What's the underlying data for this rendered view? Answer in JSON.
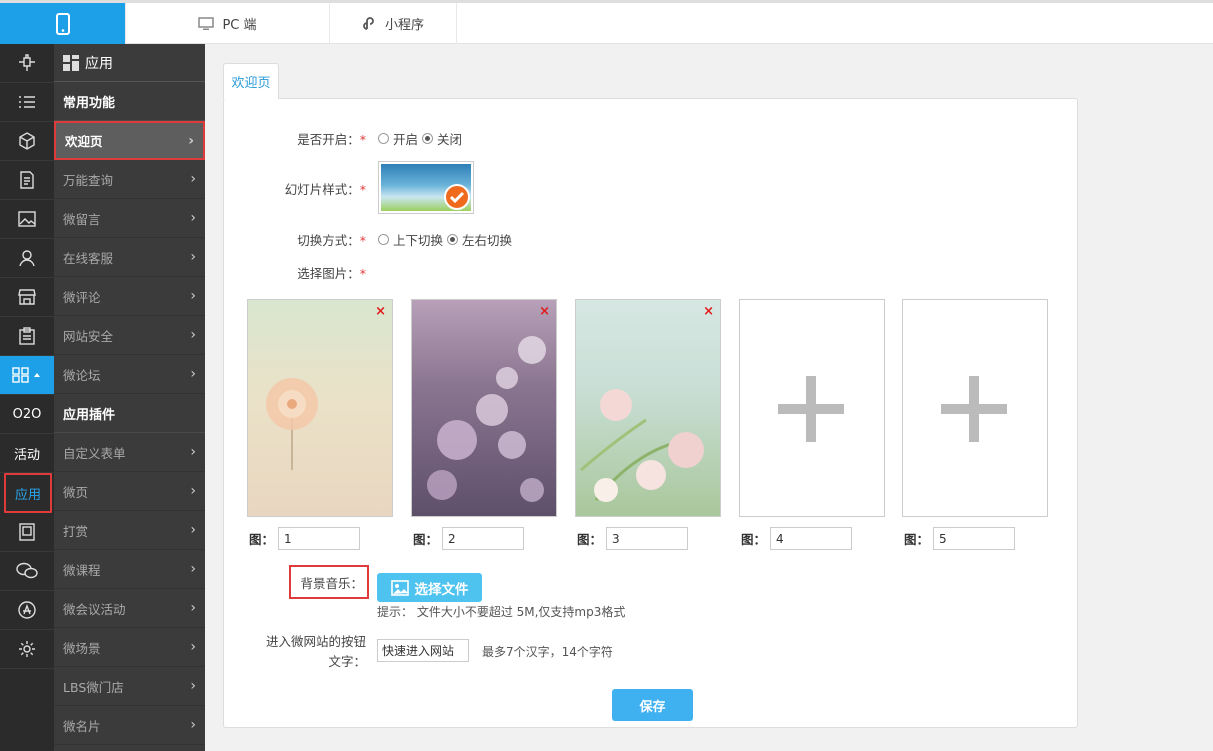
{
  "topbar": {
    "pc_label": "PC 端",
    "mini_label": "小程序"
  },
  "iconbar": {
    "items": [
      {
        "icon": "plug-icon"
      },
      {
        "icon": "list-icon"
      },
      {
        "icon": "cube-icon"
      },
      {
        "icon": "document-icon"
      },
      {
        "icon": "image-icon"
      },
      {
        "icon": "user-icon"
      },
      {
        "icon": "store-icon"
      },
      {
        "icon": "clipboard-icon"
      },
      {
        "icon": "apps-grid-icon"
      },
      {
        "label": "O2O"
      },
      {
        "label": "活动"
      },
      {
        "label": "应用"
      },
      {
        "icon": "frame-icon"
      },
      {
        "icon": "wechat-icon"
      },
      {
        "icon": "appstore-icon"
      },
      {
        "icon": "gear-icon"
      }
    ]
  },
  "menu": {
    "header": "应用",
    "section1": "常用功能",
    "items1": [
      "欢迎页",
      "万能查询",
      "微留言",
      "在线客服",
      "微评论",
      "网站安全",
      "微论坛"
    ],
    "section2": "应用插件",
    "items2": [
      "自定义表单",
      "微页",
      "打赏",
      "微课程",
      "微会议活动",
      "微场景",
      "LBS微门店",
      "微名片"
    ]
  },
  "content": {
    "tab": "欢迎页",
    "enable_label": "是否开启：",
    "enable_options": [
      "开启",
      "关闭"
    ],
    "enable_selected": "关闭",
    "slide_label": "幻灯片样式：",
    "switch_label": "切换方式：",
    "switch_options": [
      "上下切换",
      "左右切换"
    ],
    "switch_selected": "左右切换",
    "pics_label": "选择图片：",
    "required_mark": "*",
    "pic_prefix": "图：",
    "pic_values": [
      "1",
      "2",
      "3",
      "4",
      "5"
    ],
    "remove_glyph": "×",
    "music_label": "背景音乐：",
    "file_button": "选择文件",
    "file_tip": "提示： 文件大小不要超过 5M,仅支持mp3格式",
    "enter_label": "进入微网站的按钮文字：",
    "enter_value": "快速进入网站",
    "enter_hint": "最多7个汉字，14个字符",
    "save_button": "保存"
  },
  "colors": {
    "accent": "#1ea0e8",
    "highlight": "#e03b3b",
    "sidebar_dark": "#2b2b2b",
    "menu_bg": "#3b3b3b"
  }
}
